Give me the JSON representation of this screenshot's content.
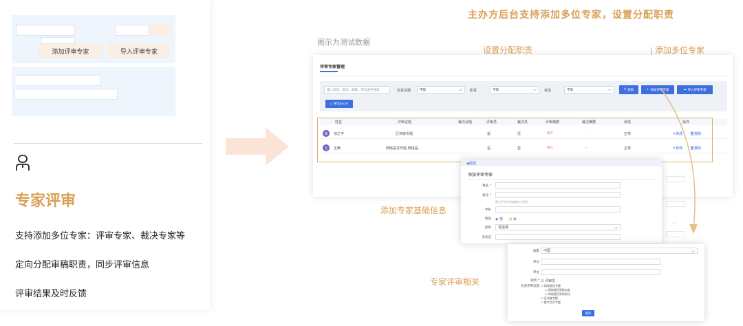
{
  "left_card": {
    "mock_buttons": [
      "添加评审专家",
      "导入评审专家"
    ],
    "icon": "expert-person-icon",
    "title": "专家评审",
    "features": [
      "支持添加多位专家：评审专家、裁决专家等",
      "定向分配审稿职责，同步评审信息",
      "评审结果及时反馈"
    ]
  },
  "headline": "主办方后台支持添加多位专家，设置分配职责",
  "note": "图示为测试数据",
  "annotations": {
    "assign_duties": "设置分配职责",
    "add_experts": "添加多位专家",
    "basic_info": "添加专家基础信息",
    "review_related": "专家评审相关"
  },
  "screen": {
    "tab": "评审专家管理",
    "search_placeholder": "输入姓名、电话、邮箱、单位进行搜索",
    "filters": [
      {
        "label": "负责议题",
        "value": "不限"
      },
      {
        "label": "职责",
        "value": "不限"
      },
      {
        "label": "状态",
        "value": "不限"
      }
    ],
    "search_btn": "搜索",
    "add_btn": "添加评审专家",
    "import_btn": "导入评审专家",
    "export_btn": "导出Excel",
    "columns": [
      "姓名",
      "评审议题",
      "裁决议题",
      "评审员",
      "裁决员",
      "评审摘要",
      "裁决摘要",
      "状态",
      "操作"
    ],
    "rows": [
      {
        "avatar": "徐",
        "name": "徐之平",
        "topic": "区块链专题",
        "judge_topic": "",
        "reviewer": "是",
        "arbiter": "否",
        "review": "0/0",
        "arbiter_summary": "-",
        "status": "正常",
        "edit": "修改",
        "delete": "删除"
      },
      {
        "avatar": "王",
        "name": "王腾",
        "topic": "网络提货专题,网络提...",
        "judge_topic": "",
        "reviewer": "是",
        "arbiter": "否",
        "review": "0/0",
        "arbiter_summary": "-",
        "status": "正常",
        "edit": "修改",
        "delete": "删除"
      }
    ]
  },
  "dialog1": {
    "back": "返回",
    "title": "添加评审专家",
    "fields": [
      "姓名 *",
      "账号 *",
      "手机",
      "性别",
      "职称",
      "身份证"
    ],
    "account_hint": "默认手机号或邮箱作为账号",
    "gender_options": [
      "男",
      "女"
    ],
    "title_value": "请选择"
  },
  "dialog2": {
    "fields": [
      "国家",
      "单位",
      "单位"
    ],
    "country": "中国",
    "duty_label": "职责 *",
    "duty_value": "评审员",
    "topic_label": "负责评审议题",
    "topics": [
      "网络提货专题",
      "网络提货采购自助",
      "网络提货采购优化",
      "区块链专题",
      "数字货币专题"
    ],
    "submit": "保存"
  },
  "colors": {
    "accent": "#d9a057",
    "blue": "#3d6fe0"
  }
}
